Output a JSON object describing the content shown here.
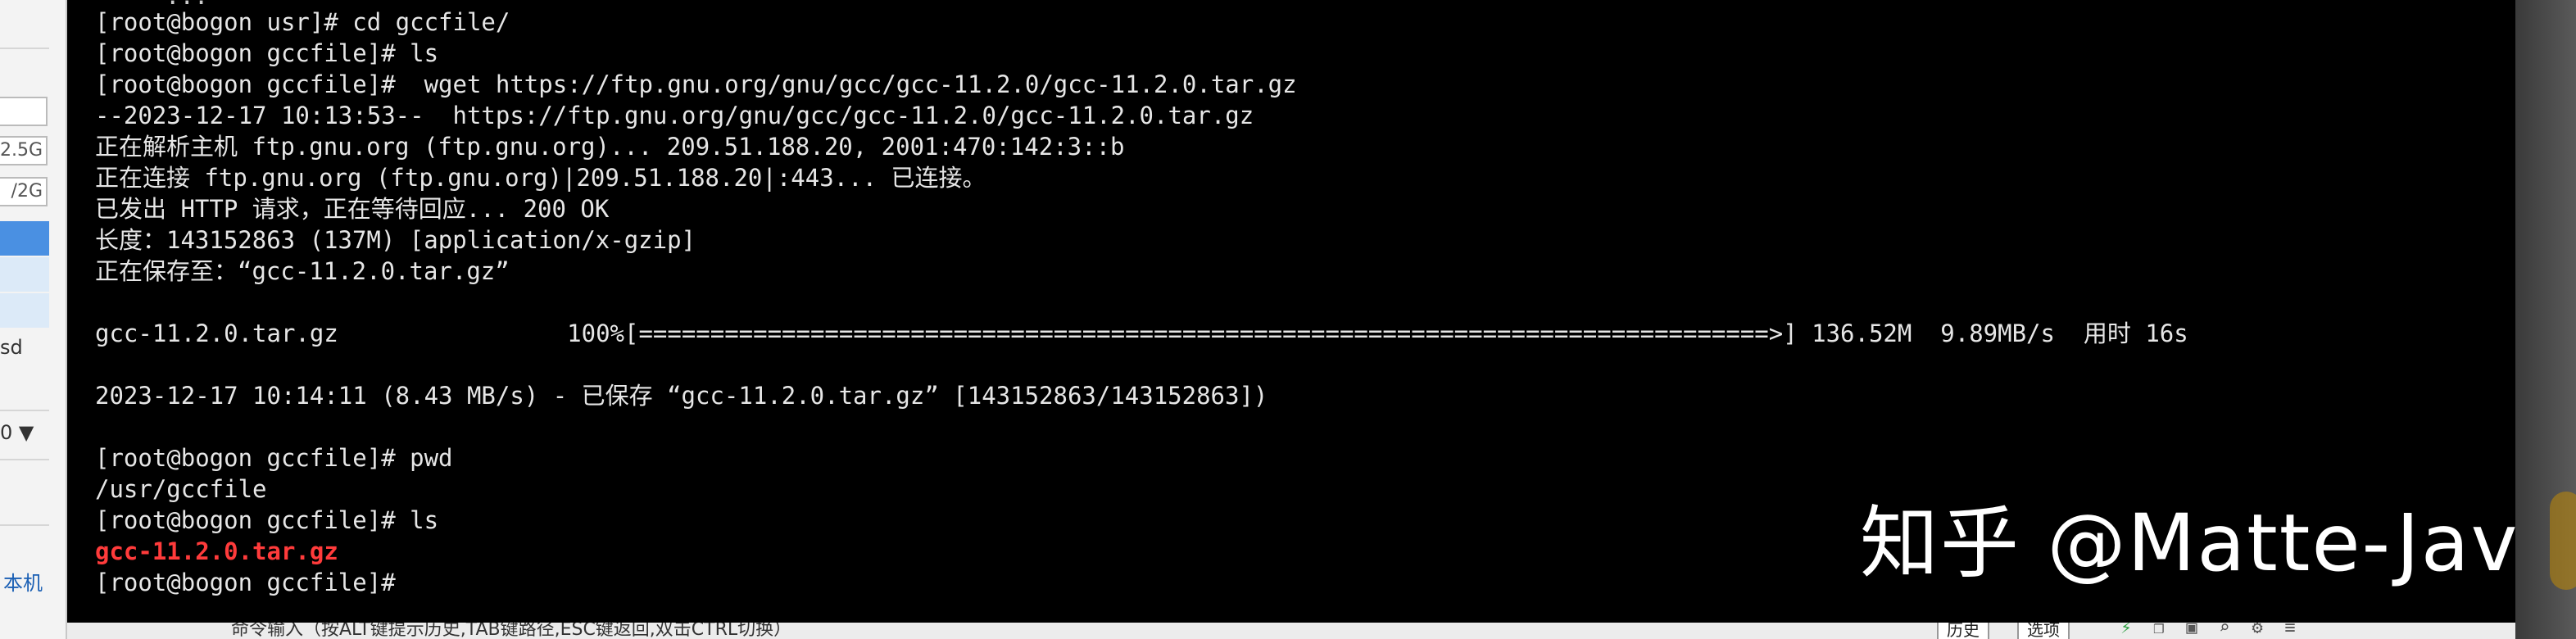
{
  "top_strip": {
    "text": "...",
    "highlight": ""
  },
  "left_pane": {
    "values": [
      "2.5G",
      "/2G"
    ],
    "labels": [
      "sd",
      "0 ▼",
      "本机"
    ]
  },
  "terminal": {
    "lines": [
      {
        "text": "[root@bogon usr]# cd gccfile/",
        "style": "normal"
      },
      {
        "text": "[root@bogon gccfile]# ls",
        "style": "normal"
      },
      {
        "text": "[root@bogon gccfile]#  wget https://ftp.gnu.org/gnu/gcc/gcc-11.2.0/gcc-11.2.0.tar.gz",
        "style": "normal"
      },
      {
        "text": "--2023-12-17 10:13:53--  https://ftp.gnu.org/gnu/gcc/gcc-11.2.0/gcc-11.2.0.tar.gz",
        "style": "normal"
      },
      {
        "text": "正在解析主机 ftp.gnu.org (ftp.gnu.org)... 209.51.188.20, 2001:470:142:3::b",
        "style": "normal"
      },
      {
        "text": "正在连接 ftp.gnu.org (ftp.gnu.org)|209.51.188.20|:443... 已连接。",
        "style": "normal"
      },
      {
        "text": "已发出 HTTP 请求，正在等待回应... 200 OK",
        "style": "normal"
      },
      {
        "text": "长度：143152863 (137M) [application/x-gzip]",
        "style": "normal"
      },
      {
        "text": "正在保存至：“gcc-11.2.0.tar.gz”",
        "style": "normal"
      },
      {
        "text": "",
        "style": "normal"
      },
      {
        "text": "gcc-11.2.0.tar.gz                100%[===============================================================================>] 136.52M  9.89MB/s  用时 16s",
        "style": "normal"
      },
      {
        "text": "",
        "style": "normal"
      },
      {
        "text": "2023-12-17 10:14:11 (8.43 MB/s) - 已保存 “gcc-11.2.0.tar.gz” [143152863/143152863])",
        "style": "normal"
      },
      {
        "text": "",
        "style": "normal"
      },
      {
        "text": "[root@bogon gccfile]# pwd",
        "style": "normal"
      },
      {
        "text": "/usr/gccfile",
        "style": "normal"
      },
      {
        "text": "[root@bogon gccfile]# ls",
        "style": "normal"
      },
      {
        "text": "gcc-11.2.0.tar.gz",
        "style": "red"
      },
      {
        "text": "[root@bogon gccfile]#",
        "style": "normal"
      }
    ]
  },
  "watermark": "知乎 @Matte-Java",
  "bottom_bar": {
    "hint": "命令输入（按ALT键提示历史,TAB键路径,ESC键返回,双击CTRL切换）",
    "buttons": [
      "历史",
      "选项"
    ]
  },
  "colors": {
    "terminal_bg": "#000000",
    "terminal_fg": "#e6e6e6",
    "highlight_red": "#ff3b3b"
  }
}
